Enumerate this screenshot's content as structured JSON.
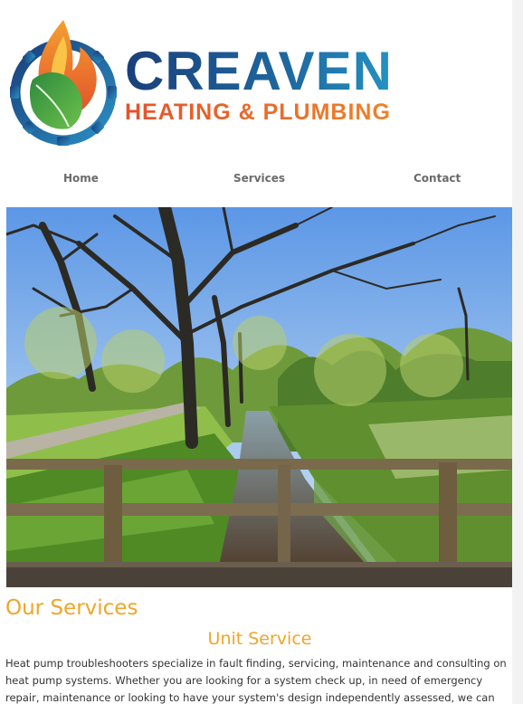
{
  "brand": {
    "name": "CREAVEN",
    "tagline": "HEATING & PLUMBING",
    "logo_icon": "flame-leaf-gear-icon",
    "colors": {
      "blue": "#1f6aa1",
      "orange": "#f08a2a",
      "green": "#3aa04a"
    }
  },
  "nav": {
    "items": [
      {
        "label": "Home"
      },
      {
        "label": "Services"
      },
      {
        "label": "Contact"
      }
    ]
  },
  "hero": {
    "image": "landscape-photo"
  },
  "services": {
    "heading": "Our Services",
    "items": [
      {
        "title": "Unit Service",
        "text": "Heat pump troubleshooters specialize in fault finding, servicing, maintenance and consulting on heat pump systems. Whether you are looking for a system check up, in need of emergency repair, maintenance or looking to have your system's design independently assessed, we can help. We can service, maintain"
      }
    ],
    "accent": "#f0a52a"
  }
}
